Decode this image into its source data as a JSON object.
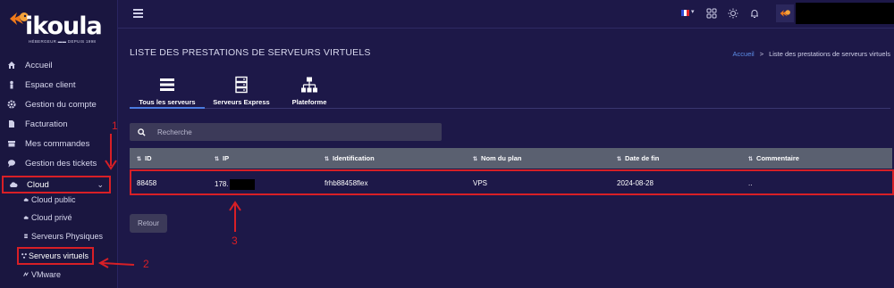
{
  "brand": {
    "name": "ikoula",
    "tagline": "HÉBERGEUR ▬▬ DEPUIS 1998"
  },
  "colors": {
    "accent_red": "#d81f26",
    "link_blue": "#5d8ee8",
    "bg": "#1d1848",
    "header_row": "#5a6070"
  },
  "sidebar": {
    "items": [
      {
        "label": "Accueil",
        "icon": "home-icon"
      },
      {
        "label": "Espace client",
        "icon": "user-icon"
      },
      {
        "label": "Gestion du compte",
        "icon": "gear-icon"
      },
      {
        "label": "Facturation",
        "icon": "file-icon"
      },
      {
        "label": "Mes commandes",
        "icon": "inbox-icon"
      },
      {
        "label": "Gestion des tickets",
        "icon": "chat-icon"
      }
    ],
    "cloud": {
      "label": "Cloud",
      "icon": "cloud-icon"
    },
    "sub_items": [
      {
        "label": "Cloud public",
        "icon": "cloud-icon"
      },
      {
        "label": "Cloud privé",
        "icon": "cloud-icon"
      },
      {
        "label": "Serveurs Physiques",
        "icon": "server-icon"
      },
      {
        "label": "Serveurs virtuels",
        "icon": "network-icon"
      },
      {
        "label": "VMware",
        "icon": "vmware-icon"
      }
    ]
  },
  "topbar": {
    "language": "FR",
    "icons": [
      "menu-icon",
      "flag-fr-icon",
      "apps-icon",
      "sun-icon",
      "bell-icon",
      "avatar"
    ]
  },
  "page": {
    "title": "LISTE DES PRESTATIONS DE SERVEURS VIRTUELS",
    "breadcrumb": {
      "home": "Accueil",
      "separator": ">",
      "current": "Liste des prestations de serveurs virtuels"
    }
  },
  "tabs": [
    {
      "label": "Tous les serveurs",
      "icon": "list-icon",
      "active": true
    },
    {
      "label": "Serveurs Express",
      "icon": "server-icon",
      "active": false
    },
    {
      "label": "Plateforme",
      "icon": "sitemap-icon",
      "active": false
    }
  ],
  "search": {
    "placeholder": "Recherche",
    "value": ""
  },
  "table": {
    "columns": [
      "ID",
      "IP",
      "Identification",
      "Nom du plan",
      "Date de fin",
      "Commentaire"
    ],
    "rows": [
      {
        "id": "88458",
        "ip": "178.",
        "identification": "frhb88458flex",
        "plan": "VPS",
        "end_date": "2024-08-28",
        "comment": ".."
      }
    ]
  },
  "buttons": {
    "back": "Retour"
  },
  "annotations": [
    "1",
    "2",
    "3"
  ]
}
